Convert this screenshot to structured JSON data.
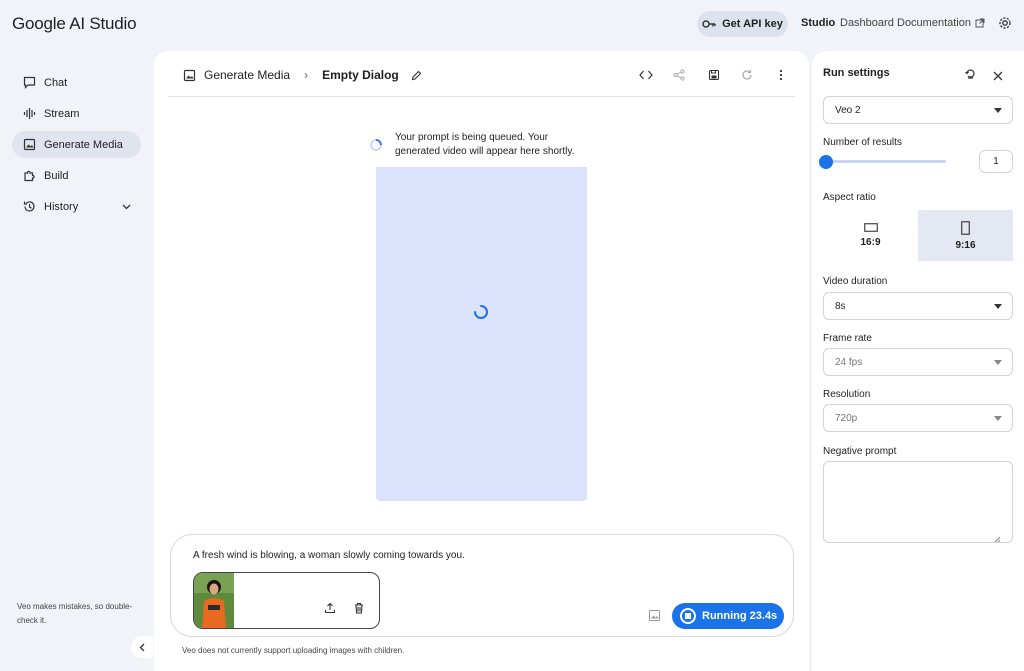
{
  "app": {
    "title": "Google AI Studio"
  },
  "header": {
    "api_key_label": "Get API key",
    "nav": [
      {
        "label": "Studio"
      },
      {
        "label": "Dashboard"
      },
      {
        "label": "Documentation"
      }
    ]
  },
  "sidebar": {
    "items": [
      {
        "label": "Chat",
        "icon": "chat-icon"
      },
      {
        "label": "Stream",
        "icon": "waveform-icon"
      },
      {
        "label": "Generate Media",
        "icon": "media-icon"
      },
      {
        "label": "Build",
        "icon": "puzzle-icon"
      },
      {
        "label": "History",
        "icon": "history-icon"
      }
    ],
    "note": "Veo makes mistakes, so double-check it."
  },
  "main": {
    "breadcrumb": {
      "section": "Generate Media",
      "title": "Empty Dialog"
    },
    "queue_message": "Your prompt is being queued. Your generated video will appear here shortly.",
    "prompt_text": "A fresh wind is blowing, a woman slowly coming towards you.",
    "run_label": "Running 23.4s",
    "footnote": "Veo does not currently support uploading images with children."
  },
  "run_settings": {
    "title": "Run settings",
    "model": "Veo 2",
    "results_label": "Number of results",
    "results_value": "1",
    "aspect_label": "Aspect ratio",
    "aspect_options": [
      {
        "label": "16:9"
      },
      {
        "label": "9:16"
      }
    ],
    "duration_label": "Video duration",
    "duration_value": "8s",
    "frame_rate_label": "Frame rate",
    "frame_rate_value": "24 fps",
    "resolution_label": "Resolution",
    "resolution_value": "720p",
    "negative_label": "Negative prompt"
  },
  "colors": {
    "accent": "#1a73e8",
    "video_placeholder": "#dbe2fb",
    "background": "#f1f3f8"
  }
}
